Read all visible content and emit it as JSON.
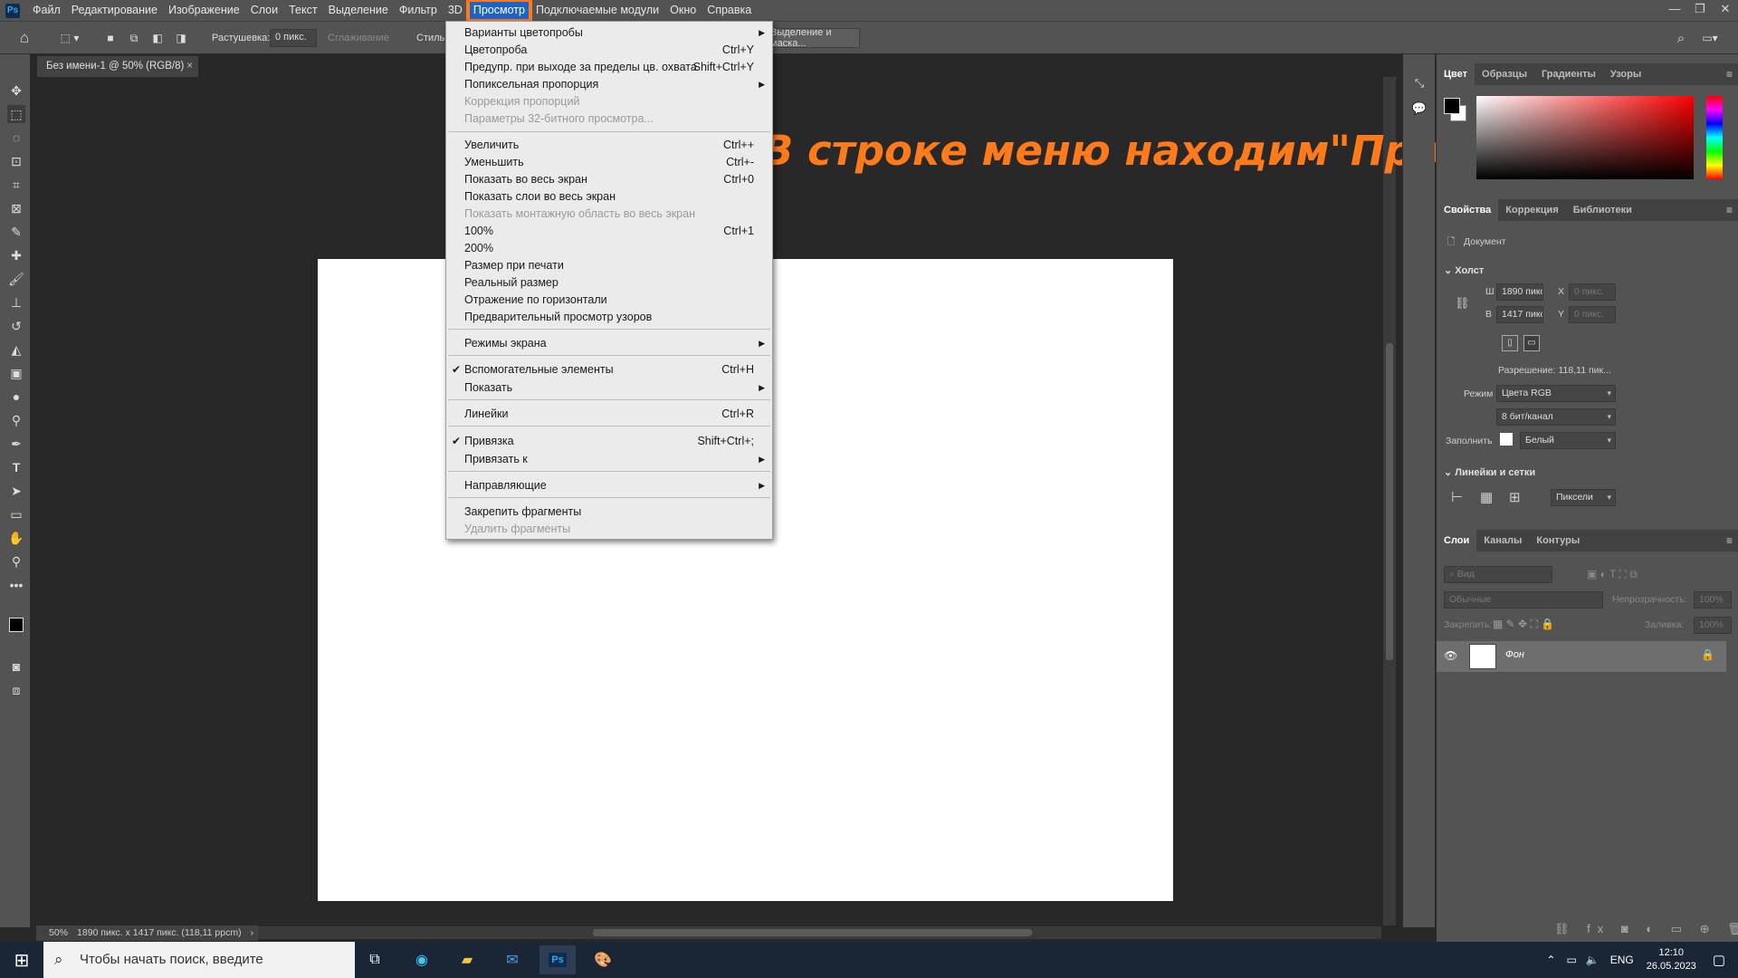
{
  "menubar": {
    "app_logo": "Ps",
    "items": [
      "Файл",
      "Редактирование",
      "Изображение",
      "Слои",
      "Текст",
      "Выделение",
      "Фильтр",
      "3D",
      "Просмотр",
      "Подключаемые модули",
      "Окно",
      "Справка"
    ],
    "active_item": "Просмотр"
  },
  "window_controls": [
    "—",
    "❐",
    "✕"
  ],
  "optbar": {
    "feather_label": "Растушевка:",
    "feather_value": "0 пикс.",
    "antialias_label": "Сглаживание",
    "style_label": "Стиль:",
    "select_mask_label": "Выделение и маска..."
  },
  "document_tab": {
    "title": "Без имени-1 @ 50% (RGB/8)",
    "close": "×"
  },
  "status": {
    "zoom": "50%",
    "info": "1890 пикс. x 1417 пикс. (118,11 ppcm)",
    "arrow": "›"
  },
  "dropdown": {
    "items": [
      {
        "label": "Варианты цветопробы",
        "shortcut": "",
        "submenu": true,
        "disabled": false,
        "checked": false
      },
      {
        "label": "Цветопроба",
        "shortcut": "Ctrl+Y",
        "submenu": false,
        "disabled": false,
        "checked": false
      },
      {
        "label": "Предупр. при выходе за пределы цв. охвата",
        "shortcut": "Shift+Ctrl+Y",
        "submenu": false,
        "disabled": false,
        "checked": false
      },
      {
        "label": "Попиксельная пропорция",
        "shortcut": "",
        "submenu": true,
        "disabled": false,
        "checked": false
      },
      {
        "label": "Коррекция пропорций",
        "shortcut": "",
        "submenu": false,
        "disabled": true,
        "checked": false
      },
      {
        "label": "Параметры 32-битного просмотра...",
        "shortcut": "",
        "submenu": false,
        "disabled": true,
        "checked": false
      },
      {
        "label": "Увеличить",
        "shortcut": "Ctrl++",
        "submenu": false,
        "disabled": false,
        "checked": false
      },
      {
        "label": "Уменьшить",
        "shortcut": "Ctrl+-",
        "submenu": false,
        "disabled": false,
        "checked": false
      },
      {
        "label": "Показать во весь экран",
        "shortcut": "Ctrl+0",
        "submenu": false,
        "disabled": false,
        "checked": false
      },
      {
        "label": "Показать слои во весь экран",
        "shortcut": "",
        "submenu": false,
        "disabled": false,
        "checked": false
      },
      {
        "label": "Показать монтажную область во весь экран",
        "shortcut": "",
        "submenu": false,
        "disabled": true,
        "checked": false
      },
      {
        "label": "100%",
        "shortcut": "Ctrl+1",
        "submenu": false,
        "disabled": false,
        "checked": false
      },
      {
        "label": "200%",
        "shortcut": "",
        "submenu": false,
        "disabled": false,
        "checked": false
      },
      {
        "label": "Размер при печати",
        "shortcut": "",
        "submenu": false,
        "disabled": false,
        "checked": false
      },
      {
        "label": "Реальный размер",
        "shortcut": "",
        "submenu": false,
        "disabled": false,
        "checked": false
      },
      {
        "label": "Отражение по горизонтали",
        "shortcut": "",
        "submenu": false,
        "disabled": false,
        "checked": false
      },
      {
        "label": "Предварительный просмотр узоров",
        "shortcut": "",
        "submenu": false,
        "disabled": false,
        "checked": false
      },
      {
        "label": "Режимы экрана",
        "shortcut": "",
        "submenu": true,
        "disabled": false,
        "checked": false
      },
      {
        "label": "Вспомогательные элементы",
        "shortcut": "Ctrl+H",
        "submenu": false,
        "disabled": false,
        "checked": true
      },
      {
        "label": "Показать",
        "shortcut": "",
        "submenu": true,
        "disabled": false,
        "checked": false
      },
      {
        "label": "Линейки",
        "shortcut": "Ctrl+R",
        "submenu": false,
        "disabled": false,
        "checked": false
      },
      {
        "label": "Привязка",
        "shortcut": "Shift+Ctrl+;",
        "submenu": false,
        "disabled": false,
        "checked": true
      },
      {
        "label": "Привязать к",
        "shortcut": "",
        "submenu": true,
        "disabled": false,
        "checked": false
      },
      {
        "label": "Направляющие",
        "shortcut": "",
        "submenu": true,
        "disabled": false,
        "checked": false
      },
      {
        "label": "Закрепить фрагменты",
        "shortcut": "",
        "submenu": false,
        "disabled": false,
        "checked": false
      },
      {
        "label": "Удалить фрагменты",
        "shortcut": "",
        "submenu": false,
        "disabled": true,
        "checked": false
      }
    ]
  },
  "annotation": {
    "text": "В строке меню находим\"Просмотр\"",
    "color": "#ff7a1a"
  },
  "color_panel": {
    "tabs": [
      "Цвет",
      "Образцы",
      "Градиенты",
      "Узоры"
    ],
    "active": "Цвет"
  },
  "properties_panel": {
    "tabs": [
      "Свойства",
      "Коррекция",
      "Библиотеки"
    ],
    "active": "Свойства",
    "doc_label": "Документ",
    "canvas_section": "Холст",
    "width_label": "Ш",
    "width_value": "1890 пикс.",
    "height_label": "В",
    "height_value": "1417 пикс.",
    "x_label": "X",
    "x_placeholder": "0 пикс.",
    "y_label": "Y",
    "y_placeholder": "0 пикс.",
    "resolution": "Разрешение: 118,11 пик...",
    "mode_label": "Режим",
    "mode_value": "Цвета RGB",
    "depth_value": "8 бит/канал",
    "fill_label": "Заполнить",
    "fill_value": "Белый",
    "rulers_section": "Линейки и сетки",
    "units_value": "Пиксели"
  },
  "layers_panel": {
    "tabs": [
      "Слои",
      "Каналы",
      "Контуры"
    ],
    "active": "Слои",
    "search_placeholder": "Вид",
    "blend_mode": "Обычные",
    "opacity_label": "Непрозрачность:",
    "opacity_value": "100%",
    "lock_label": "Закрепить:",
    "fill_label": "Заливка:",
    "fill_value": "100%",
    "layers": [
      {
        "name": "Фон",
        "visible": true,
        "locked": true
      }
    ]
  },
  "taskbar": {
    "search_placeholder": "Чтобы начать поиск, введите",
    "lang": "ENG",
    "time": "12:10",
    "date": "26.05.2023"
  }
}
